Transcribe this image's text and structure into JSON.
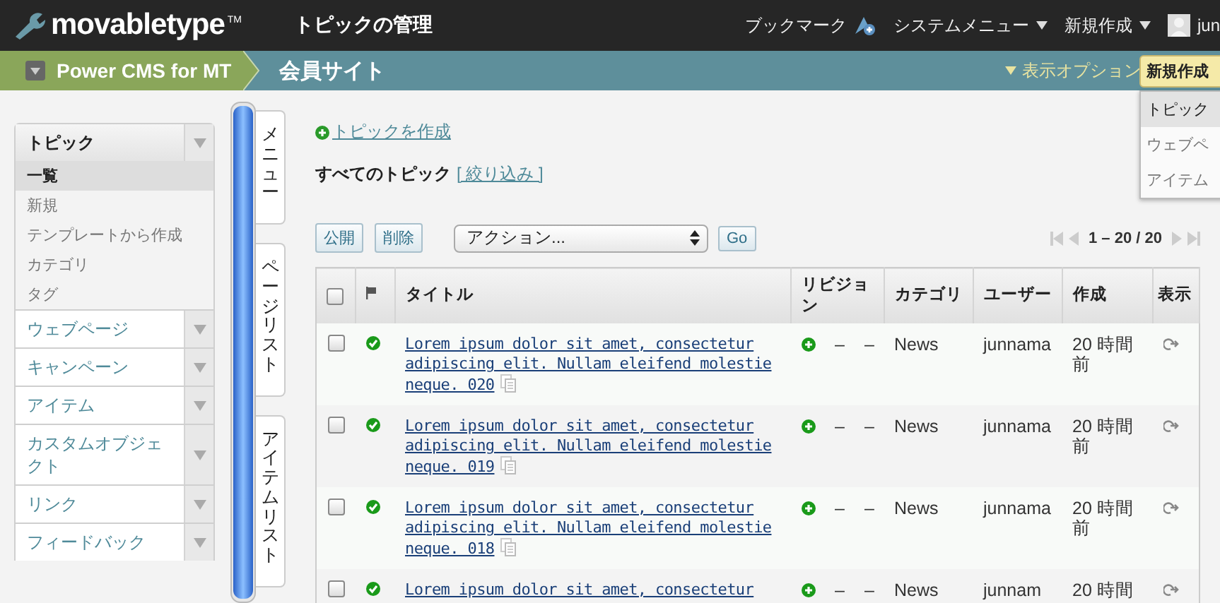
{
  "header": {
    "logo": "movabletype",
    "logo_mark": "TM",
    "title": "トピックの管理",
    "nav": [
      {
        "label": "ブックマーク",
        "kind": "bookmark"
      },
      {
        "label": "システムメニュー",
        "kind": "menu"
      },
      {
        "label": "新規作成",
        "kind": "menu"
      },
      {
        "label": "jun",
        "kind": "user"
      }
    ]
  },
  "site_bar": {
    "site_switcher": "Power CMS for MT",
    "current_site": "会員サイト",
    "display_options": "表示オプション"
  },
  "create_menu": {
    "button": "新規作成",
    "items": [
      {
        "label": "トピック",
        "selected": true
      },
      {
        "label": "ウェブペ",
        "selected": false
      },
      {
        "label": "アイテム",
        "selected": false
      }
    ]
  },
  "sidebar": {
    "groups": [
      {
        "label": "トピック",
        "expanded": true,
        "children": [
          {
            "label": "一覧",
            "selected": true
          },
          {
            "label": "新規",
            "selected": false
          },
          {
            "label": "テンプレートから作成",
            "selected": false
          },
          {
            "label": "カテゴリ",
            "selected": false
          },
          {
            "label": "タグ",
            "selected": false
          }
        ]
      },
      {
        "label": "ウェブページ",
        "expanded": false
      },
      {
        "label": "キャンペーン",
        "expanded": false
      },
      {
        "label": "アイテム",
        "expanded": false
      },
      {
        "label": "カスタムオブジェクト",
        "expanded": false
      },
      {
        "label": "リンク",
        "expanded": false
      },
      {
        "label": "フィードバック",
        "expanded": false
      }
    ]
  },
  "side_tabs": [
    "メニュー",
    "ページリスト",
    "アイテムリスト"
  ],
  "content": {
    "create_link": "トピックを作成",
    "list_title": "すべてのトピック",
    "filter_link": "[ 絞り込み ]",
    "buttons": [
      "公開",
      "削除"
    ],
    "action_select": "アクション...",
    "go_button": "Go",
    "pagination": "1 – 20 / 20"
  },
  "table": {
    "header_checked": false,
    "columns": [
      {
        "kind": "checkbox"
      },
      {
        "kind": "flag"
      },
      {
        "kind": "text",
        "label": "タイトル"
      },
      {
        "kind": "text",
        "label": "リビジョン"
      },
      {
        "kind": "text",
        "label": "カテゴリ"
      },
      {
        "kind": "text",
        "label": "ユーザー"
      },
      {
        "kind": "text",
        "label": "作成"
      },
      {
        "kind": "text",
        "label": "表示"
      }
    ],
    "rows": [
      {
        "checked": false,
        "published": true,
        "title": "Lorem ipsum dolor sit amet, consectetur adipiscing elit. Nullam eleifend molestie neque. 020",
        "revision": [
          "–",
          "–"
        ],
        "category": "News",
        "user": "junnama",
        "created": "20 時間前"
      },
      {
        "checked": false,
        "published": true,
        "title": "Lorem ipsum dolor sit amet, consectetur adipiscing elit. Nullam eleifend molestie neque. 019",
        "revision": [
          "–",
          "–"
        ],
        "category": "News",
        "user": "junnama",
        "created": "20 時間前"
      },
      {
        "checked": false,
        "published": true,
        "title": "Lorem ipsum dolor sit amet, consectetur adipiscing elit. Nullam eleifend molestie neque. 018",
        "revision": [
          "–",
          "–"
        ],
        "category": "News",
        "user": "junnama",
        "created": "20 時間前"
      },
      {
        "checked": false,
        "published": true,
        "title": "Lorem ipsum dolor sit amet, consectetur",
        "revision": [
          "–",
          "–"
        ],
        "category": "News",
        "user": "junnam",
        "created": "20 時間"
      }
    ]
  }
}
